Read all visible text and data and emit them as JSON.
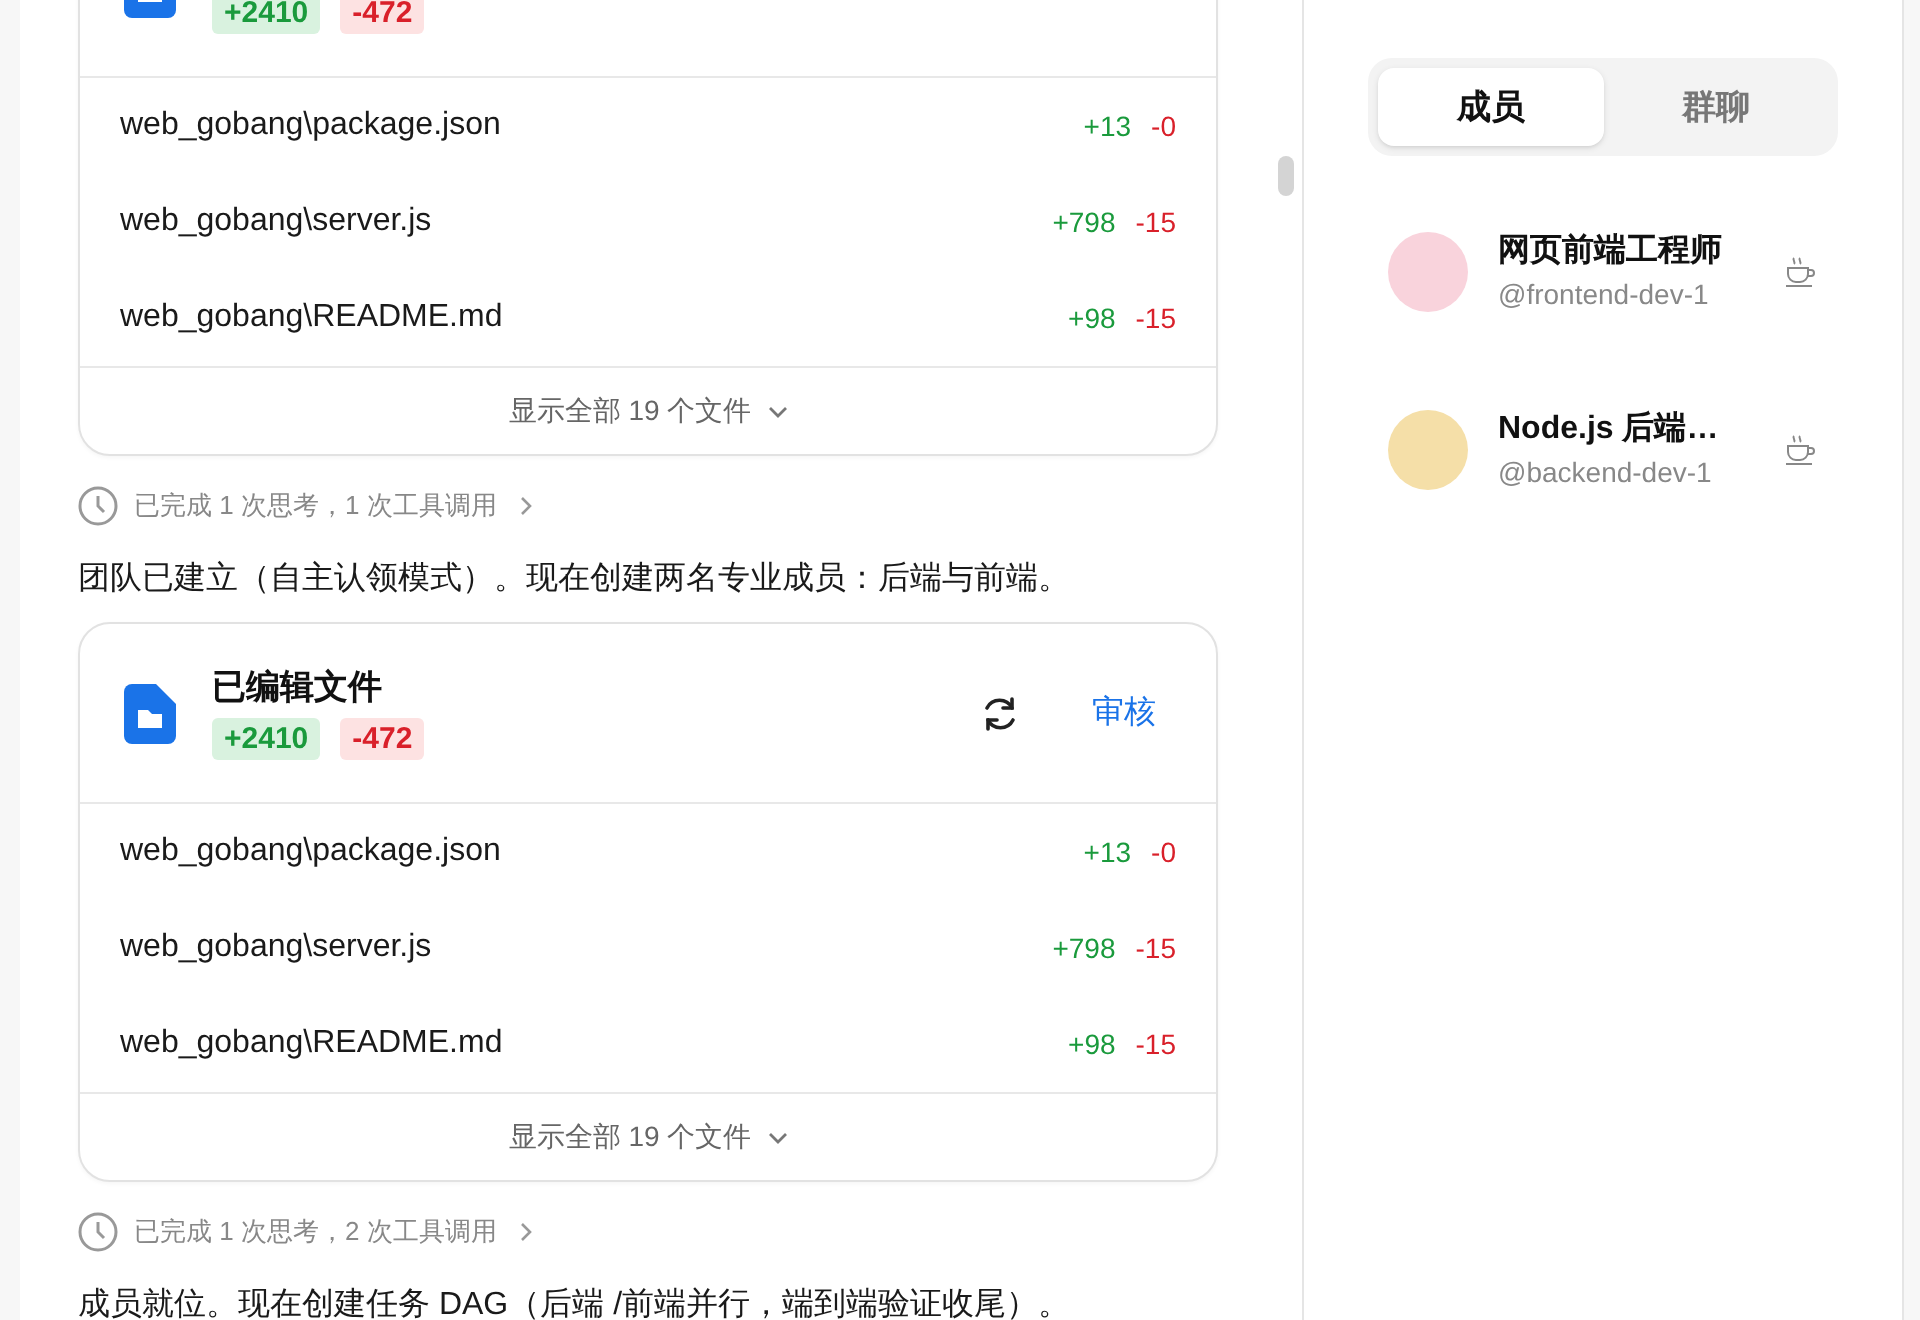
{
  "messages": [
    {
      "kind": "files_card",
      "added": "+2410",
      "removed": "-472",
      "files": [
        {
          "path": "web_gobang\\package.json",
          "added": "+13",
          "removed": "-0"
        },
        {
          "path": "web_gobang\\server.js",
          "added": "+798",
          "removed": "-15"
        },
        {
          "path": "web_gobang\\README.md",
          "added": "+98",
          "removed": "-15"
        }
      ],
      "show_all": "显示全部 19 个文件"
    },
    {
      "kind": "status",
      "text": "已完成 1 次思考，1 次工具调用"
    },
    {
      "kind": "text",
      "text": "团队已建立（自主认领模式）。现在创建两名专业成员：后端与前端。"
    },
    {
      "kind": "files_card",
      "title": "已编辑文件",
      "added": "+2410",
      "removed": "-472",
      "review": "审核",
      "files": [
        {
          "path": "web_gobang\\package.json",
          "added": "+13",
          "removed": "-0"
        },
        {
          "path": "web_gobang\\server.js",
          "added": "+798",
          "removed": "-15"
        },
        {
          "path": "web_gobang\\README.md",
          "added": "+98",
          "removed": "-15"
        }
      ],
      "show_all": "显示全部 19 个文件"
    },
    {
      "kind": "status",
      "text": "已完成 1 次思考，2 次工具调用"
    },
    {
      "kind": "text",
      "text": "成员就位。现在创建任务 DAG（后端 /前端并行，端到端验证收尾）。"
    }
  ],
  "tabs": [
    {
      "label": "成员",
      "selected": true
    },
    {
      "label": "群聊",
      "selected": false
    }
  ],
  "members": [
    {
      "name": "网页前端工程师",
      "handle": "@frontend-dev-1",
      "color": "#f9d3dc"
    },
    {
      "name": "Node.js 后端…",
      "handle": "@backend-dev-1",
      "color": "#f5dfa8"
    }
  ]
}
